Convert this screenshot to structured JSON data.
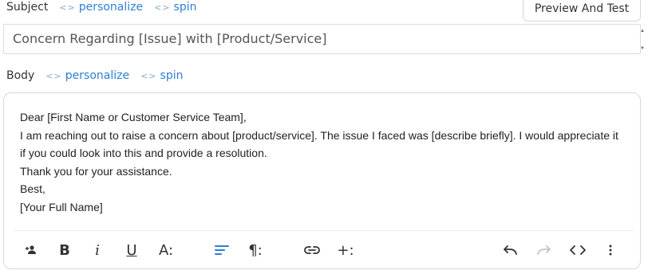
{
  "subject": {
    "label": "Subject",
    "personalize": "personalize",
    "spin": "spin",
    "value": "Concern Regarding [Issue] with [Product/Service]"
  },
  "preview_button": "Preview And Test",
  "body": {
    "label": "Body",
    "personalize": "personalize",
    "spin": "spin",
    "lines": [
      "Dear [First Name or Customer Service Team],",
      "I am reaching out to raise a concern about [product/service]. The issue I faced was [describe briefly]. I would appreciate it",
      "if you could look into this and provide a resolution.",
      "Thank you for your assistance.",
      "Best,",
      "[Your Full Name]"
    ]
  },
  "toolbar": {
    "bold": "B",
    "italic": "i",
    "underline": "U",
    "font_size": "A:",
    "paragraph": "¶:",
    "more_insert": "+:",
    "code": "<>",
    "more": "⋮"
  },
  "colors": {
    "accent": "#2d7fd3",
    "active_icon": "#2d7fd3",
    "disabled_icon": "#c4c4c4",
    "border": "#d9d9d9"
  },
  "icons": {
    "personalize_tag": "code-brackets-icon",
    "spin_tag": "code-brackets-icon",
    "toolbar": [
      "person-add-icon",
      "bold-icon",
      "italic-icon",
      "underline-icon",
      "font-size-icon",
      "align-left-icon",
      "paragraph-icon",
      "link-icon",
      "insert-icon",
      "undo-icon",
      "redo-icon",
      "code-icon",
      "more-vertical-icon"
    ]
  }
}
